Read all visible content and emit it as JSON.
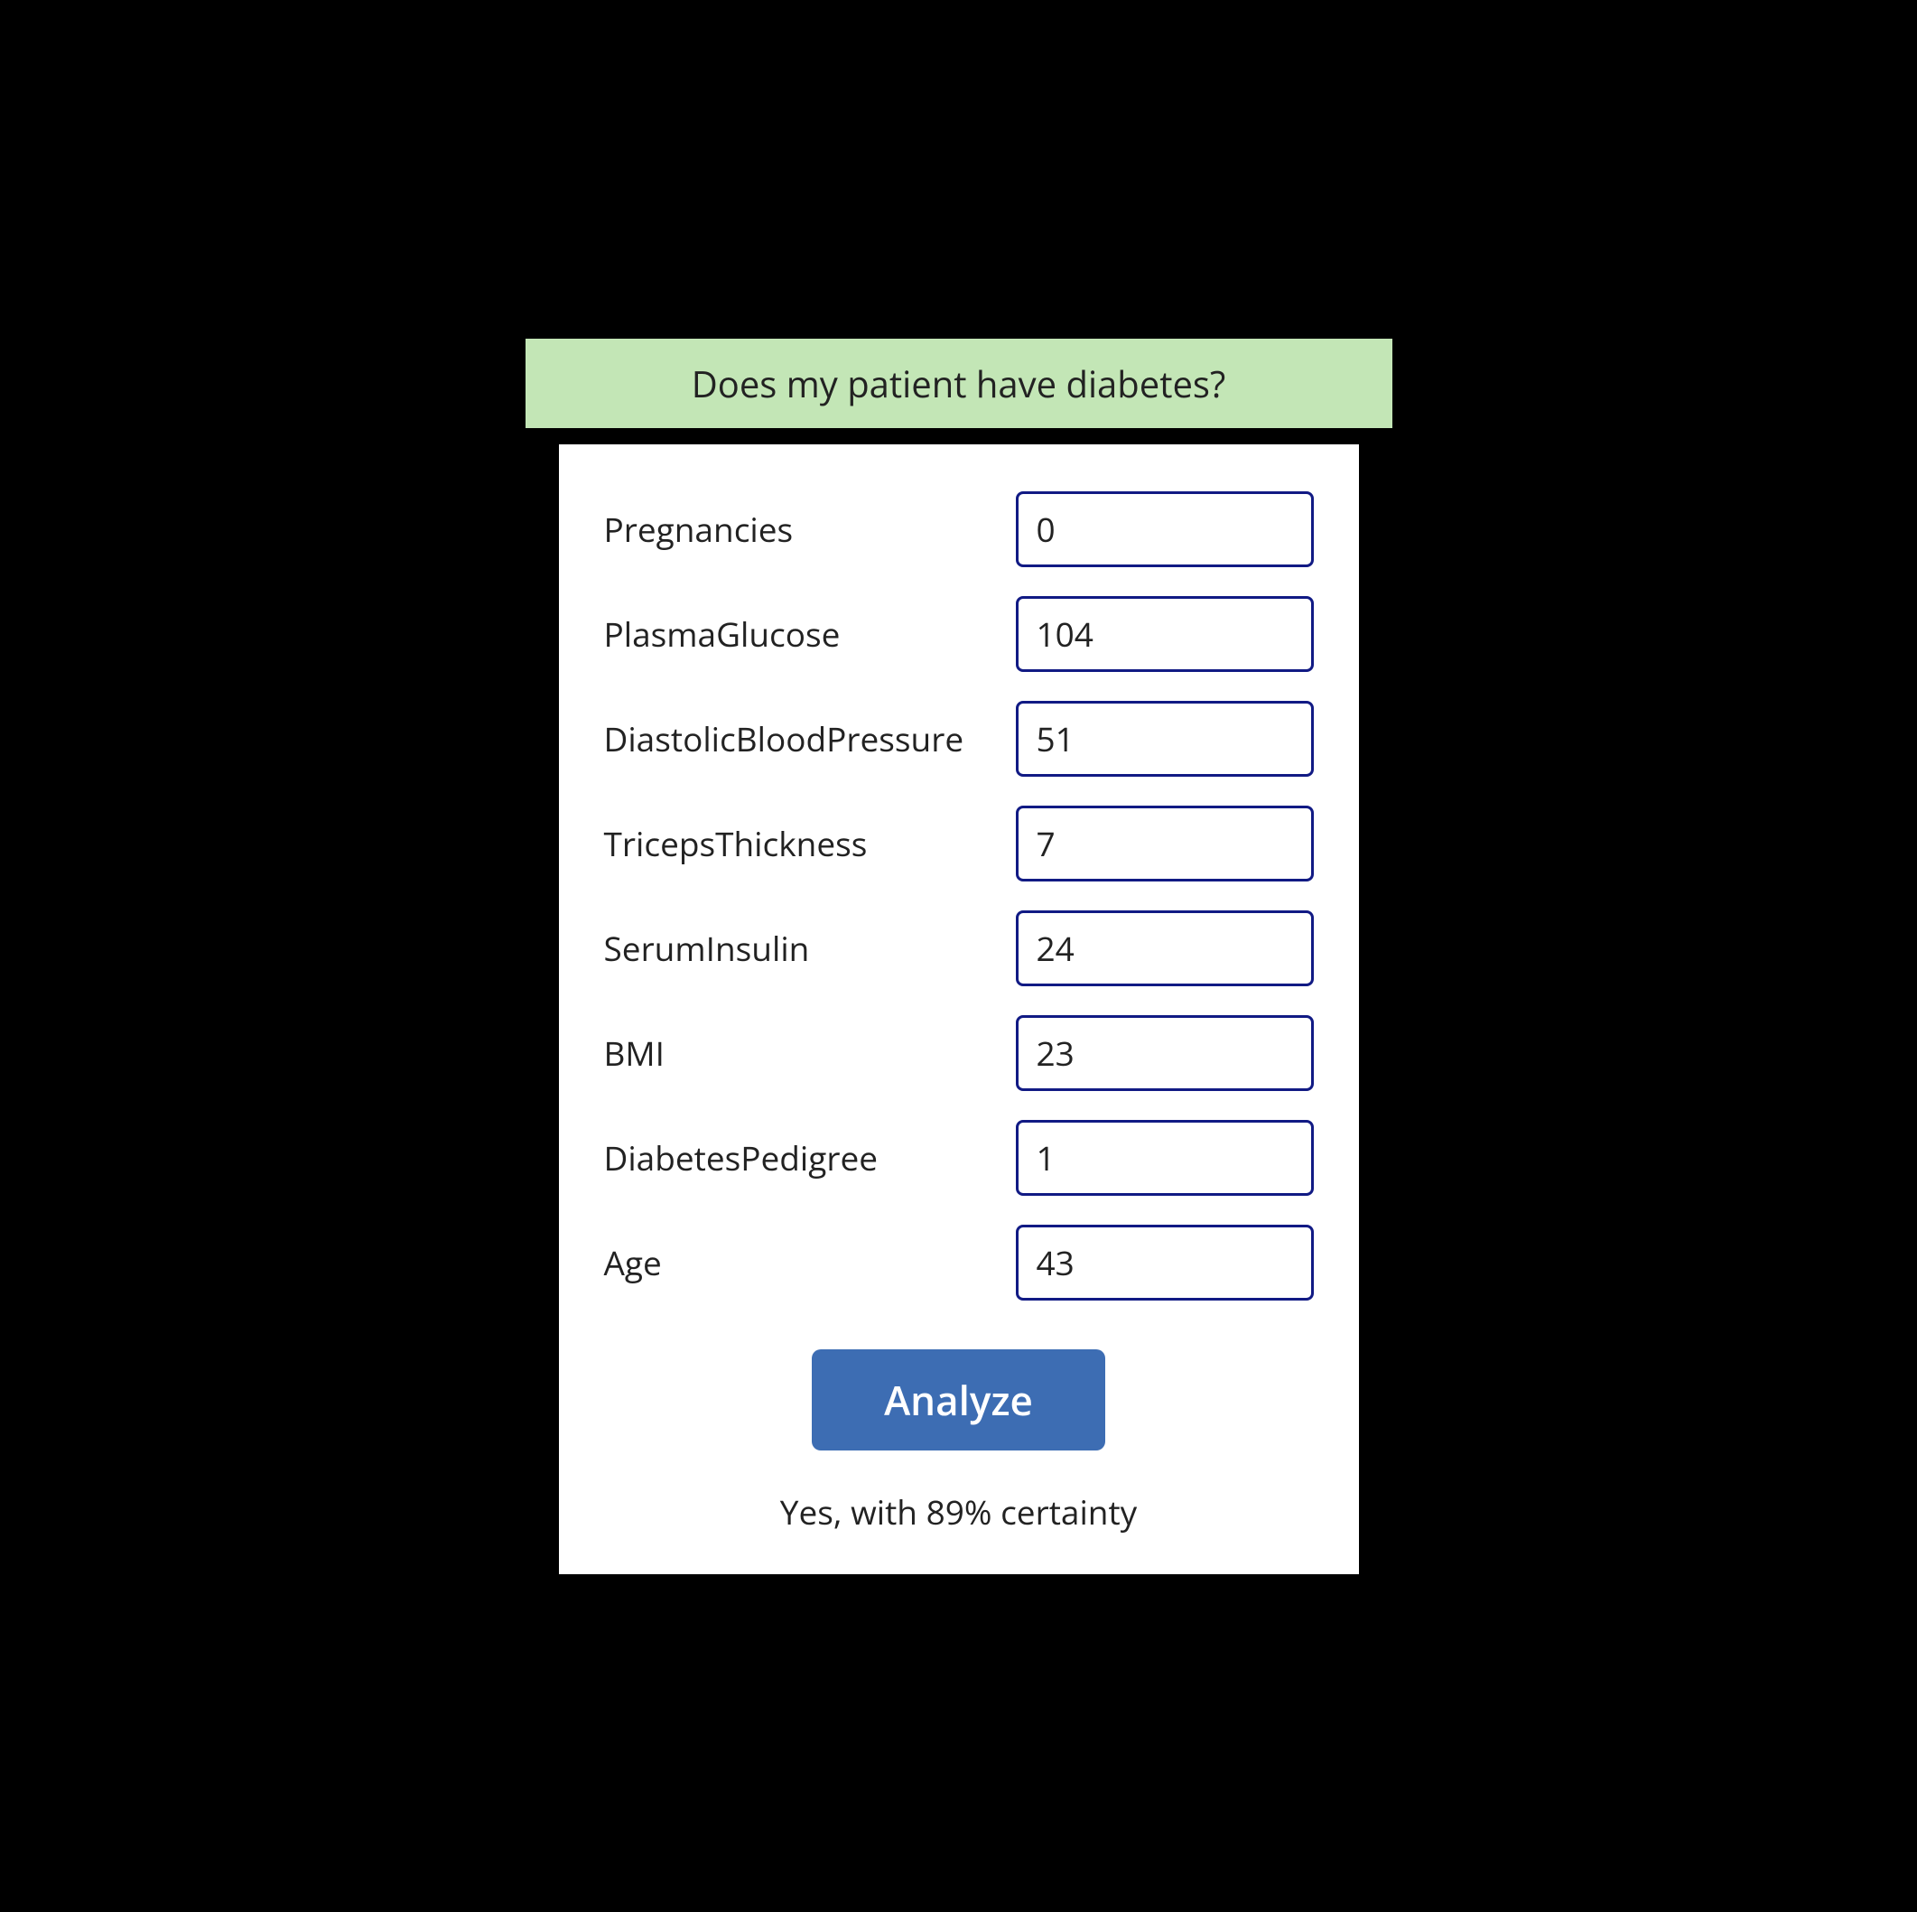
{
  "header": {
    "title": "Does my patient have diabetes?"
  },
  "form": {
    "fields": [
      {
        "label": "Pregnancies",
        "value": "0"
      },
      {
        "label": "PlasmaGlucose",
        "value": "104"
      },
      {
        "label": "DiastolicBloodPressure",
        "value": "51"
      },
      {
        "label": "TricepsThickness",
        "value": "7"
      },
      {
        "label": "SerumInsulin",
        "value": "24"
      },
      {
        "label": "BMI",
        "value": "23"
      },
      {
        "label": "DiabetesPedigree",
        "value": "1"
      },
      {
        "label": "Age",
        "value": "43"
      }
    ],
    "button_label": "Analyze"
  },
  "result": {
    "text": "Yes, with 89% certainty"
  }
}
